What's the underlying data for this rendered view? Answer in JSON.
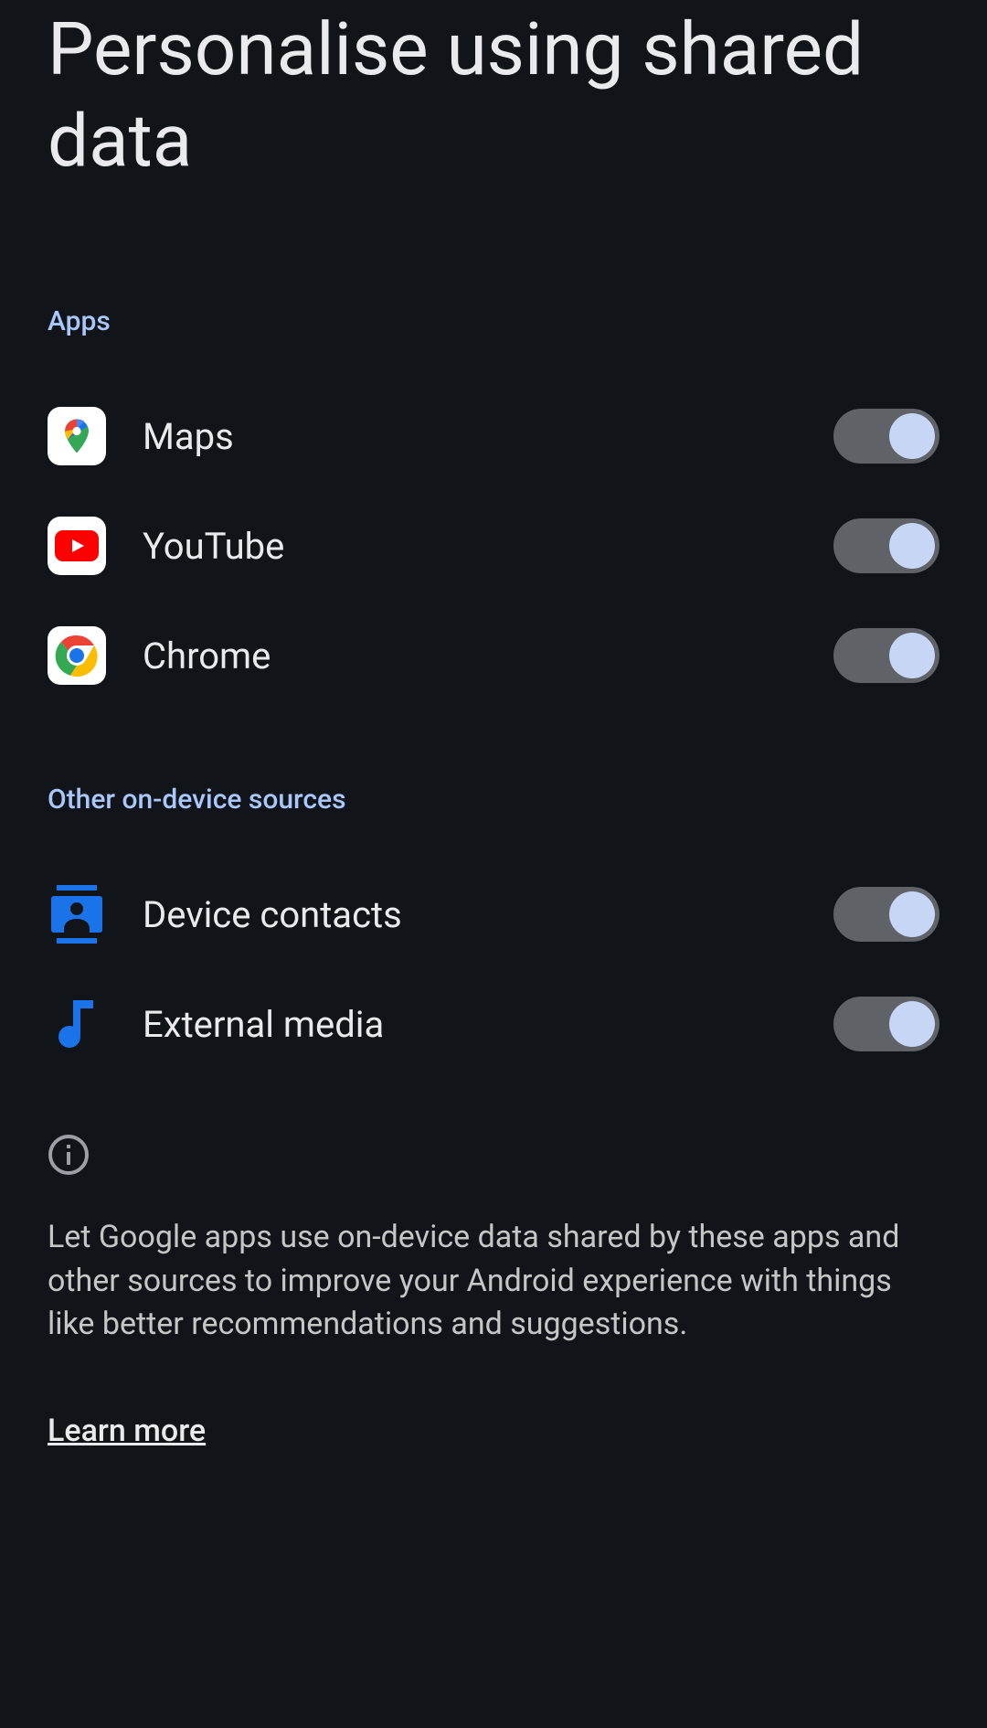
{
  "title": "Personalise using shared data",
  "sections": {
    "apps": {
      "header": "Apps",
      "items": [
        {
          "label": "Maps",
          "icon": "maps-icon",
          "enabled": true
        },
        {
          "label": "YouTube",
          "icon": "youtube-icon",
          "enabled": true
        },
        {
          "label": "Chrome",
          "icon": "chrome-icon",
          "enabled": true
        }
      ]
    },
    "other": {
      "header": "Other on-device sources",
      "items": [
        {
          "label": "Device contacts",
          "icon": "contacts-icon",
          "enabled": true
        },
        {
          "label": "External media",
          "icon": "music-icon",
          "enabled": true
        }
      ]
    }
  },
  "info": {
    "description": "Let Google apps use on-device data shared by these apps and other sources to improve your Android experience with things like better recommendations and suggestions.",
    "learn_more": "Learn more"
  }
}
